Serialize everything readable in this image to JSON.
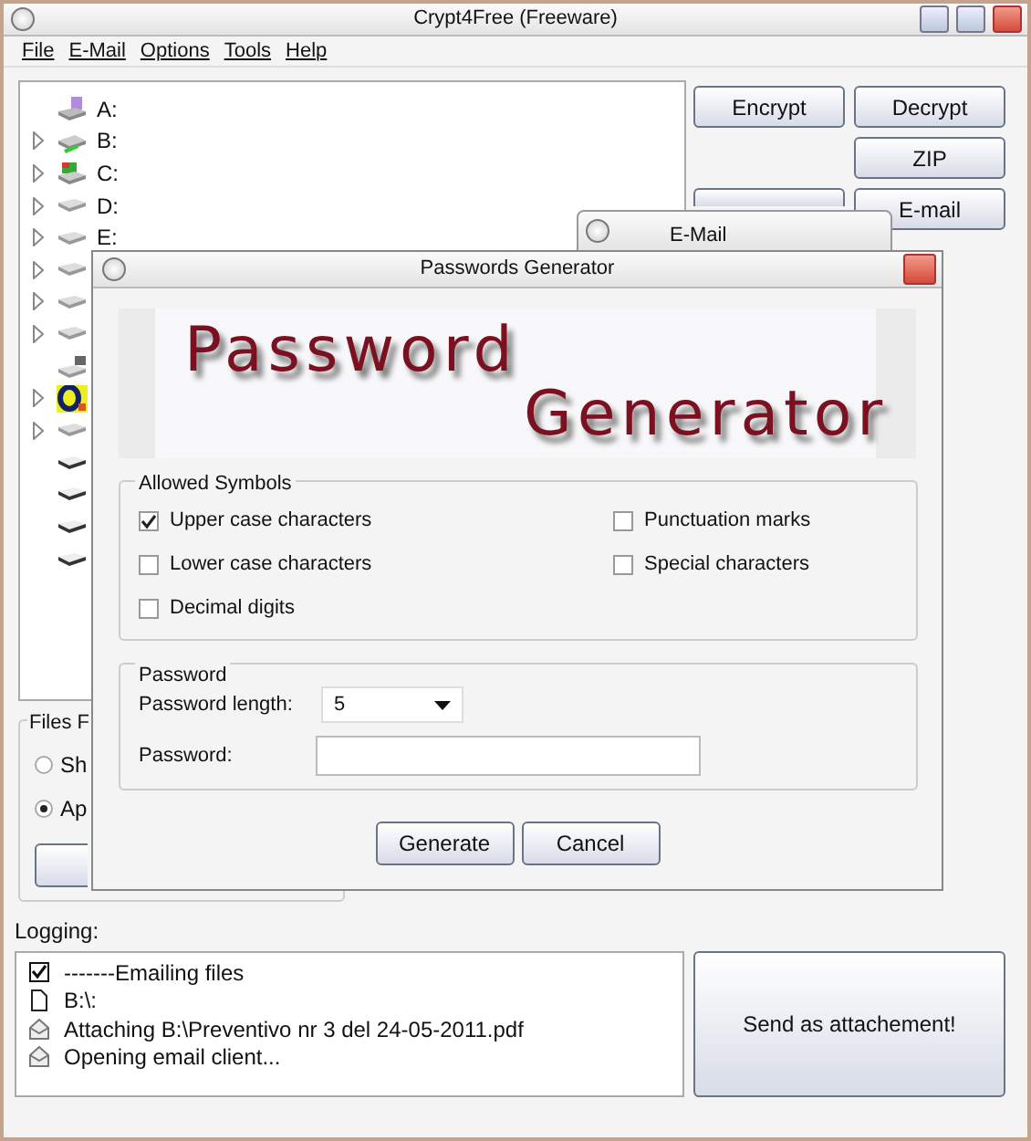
{
  "window": {
    "title": "Crypt4Free (Freeware)"
  },
  "menu": [
    "File",
    "E-Mail",
    "Options",
    "Tools",
    "Help"
  ],
  "drive_tree": [
    {
      "label": "A:",
      "kind": "floppy",
      "expandable": false
    },
    {
      "label": "B:",
      "kind": "usb",
      "expandable": true
    },
    {
      "label": "C:",
      "kind": "system",
      "expandable": true
    },
    {
      "label": "D:",
      "kind": "drive",
      "expandable": true
    },
    {
      "label": "E:",
      "kind": "drive",
      "expandable": true
    },
    {
      "kind": "drive",
      "expandable": true
    },
    {
      "kind": "drive",
      "expandable": true
    },
    {
      "kind": "drive",
      "expandable": true
    },
    {
      "kind": "network",
      "expandable": false
    },
    {
      "kind": "media",
      "expandable": true
    },
    {
      "kind": "drive",
      "expandable": true
    },
    {
      "kind": "removable",
      "expandable": false
    },
    {
      "kind": "removable",
      "expandable": false
    },
    {
      "kind": "removable",
      "expandable": false
    },
    {
      "kind": "removable",
      "expandable": false
    }
  ],
  "action_buttons": [
    "Encrypt",
    "Decrypt",
    "ZIP",
    "E-mail"
  ],
  "files_group": {
    "title": "Files F",
    "options": [
      {
        "label": "Sh",
        "selected": false
      },
      {
        "label": "Ap",
        "selected": true
      }
    ]
  },
  "logging": {
    "label": "Logging:",
    "entries": [
      {
        "kind": "check",
        "text": "-------Emailing files"
      },
      {
        "kind": "file",
        "text": "B:\\:"
      },
      {
        "kind": "mail",
        "text": "Attaching B:\\Preventivo nr 3 del 24-05-2011.pdf"
      },
      {
        "kind": "mail",
        "text": "Opening email client..."
      }
    ]
  },
  "send_button": "Send as attachement!",
  "email_window": {
    "title": "E-Mail"
  },
  "dialog": {
    "title": "Passwords Generator",
    "banner": [
      "Password",
      "Generator"
    ],
    "allowed_symbols": {
      "title": "Allowed Symbols",
      "options": [
        {
          "label": "Upper case characters",
          "checked": true
        },
        {
          "label": "Punctuation marks",
          "checked": false
        },
        {
          "label": "Lower case characters",
          "checked": false
        },
        {
          "label": "Special characters",
          "checked": false
        },
        {
          "label": "Decimal digits",
          "checked": false
        }
      ]
    },
    "password": {
      "title": "Password",
      "length_label": "Password length:",
      "length_value": "5",
      "password_label": "Password:"
    },
    "buttons": [
      "Generate",
      "Cancel"
    ]
  }
}
